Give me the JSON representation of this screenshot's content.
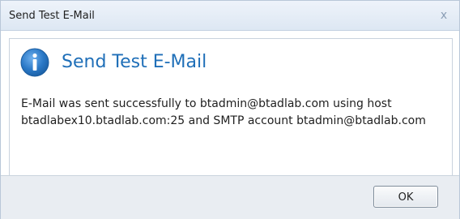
{
  "window": {
    "title": "Send Test E-Mail",
    "close_glyph": "x"
  },
  "content": {
    "icon": "info-icon",
    "heading": "Send Test E-Mail",
    "message": "E-Mail was sent successfully to btadmin@btadlab.com using host btadlabex10.btadlab.com:25 and SMTP account btadmin@btadlab.com"
  },
  "footer": {
    "ok_label": "OK"
  },
  "colors": {
    "accent": "#1f6fb8",
    "icon_blue": "#2a78c6",
    "titlebar": "#dde7f3",
    "footer": "#e9edf2"
  }
}
